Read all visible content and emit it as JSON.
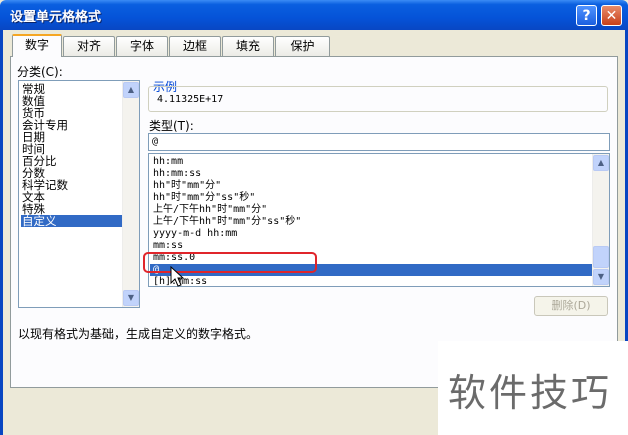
{
  "window": {
    "title": "设置单元格格式"
  },
  "tabs": [
    {
      "label": "数字",
      "active": true
    },
    {
      "label": "对齐"
    },
    {
      "label": "字体"
    },
    {
      "label": "边框"
    },
    {
      "label": "填充"
    },
    {
      "label": "保护"
    }
  ],
  "category": {
    "label": "分类(C):",
    "items": [
      "常规",
      "数值",
      "货币",
      "会计专用",
      "日期",
      "时间",
      "百分比",
      "分数",
      "科学记数",
      "文本",
      "特殊",
      "自定义"
    ],
    "selected": "自定义"
  },
  "sample": {
    "label": "示例",
    "value": "4.11325E+17"
  },
  "type": {
    "label": "类型(T):",
    "input_value": "@",
    "items": [
      "hh:mm",
      "hh:mm:ss",
      "hh\"时\"mm\"分\"",
      "hh\"时\"mm\"分\"ss\"秒\"",
      "上午/下午hh\"时\"mm\"分\"",
      "上午/下午hh\"时\"mm\"分\"ss\"秒\"",
      "yyyy-m-d hh:mm",
      "mm:ss",
      "mm:ss.0",
      "@",
      "[h]:mm:ss"
    ],
    "selected": "@"
  },
  "buttons": {
    "delete": "删除(D)"
  },
  "description": "以现有格式为基础，生成自定义的数字格式。",
  "watermark": "软件技巧",
  "colors": {
    "title_bar": "#0553d8",
    "selection": "#316ac5",
    "highlight_border": "#e0252b",
    "active_tab_accent": "#f5a623"
  }
}
